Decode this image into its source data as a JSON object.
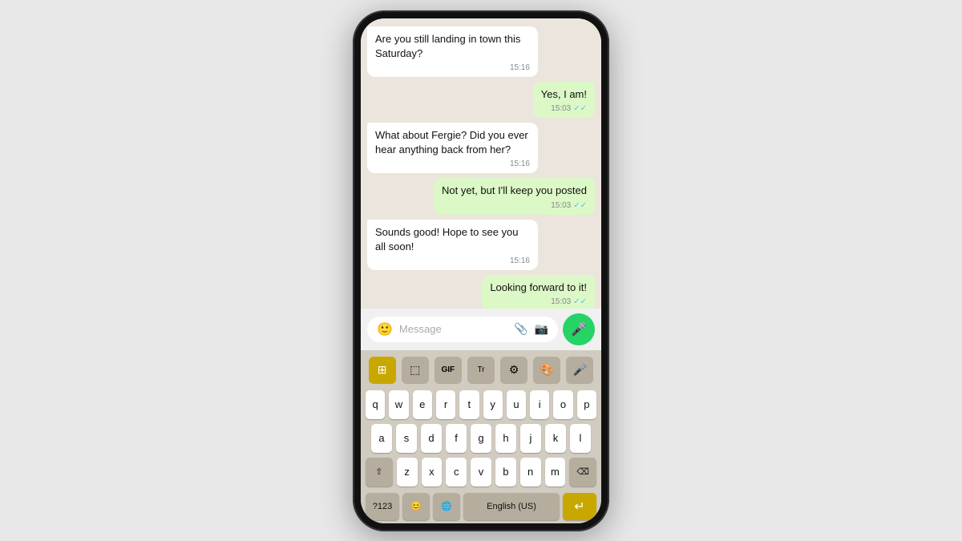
{
  "phone": {
    "messages": [
      {
        "id": "msg1",
        "type": "received",
        "text": "Are you still landing in town this Saturday?",
        "time": "15:16",
        "ticks": null
      },
      {
        "id": "msg2",
        "type": "sent",
        "text": "Yes, I am!",
        "time": "15:03",
        "ticks": "✓✓"
      },
      {
        "id": "msg3",
        "type": "received",
        "text": "What about Fergie? Did you ever hear anything back from her?",
        "time": "15:16",
        "ticks": null
      },
      {
        "id": "msg4",
        "type": "sent",
        "text": "Not yet, but I'll keep you posted",
        "time": "15:03",
        "ticks": "✓✓"
      },
      {
        "id": "msg5",
        "type": "received",
        "text": "Sounds good! Hope to see you all soon!",
        "time": "15:16",
        "ticks": null
      },
      {
        "id": "msg6",
        "type": "sent",
        "text": "Looking forward to it!",
        "time": "15:03",
        "ticks": "✓✓"
      }
    ],
    "input": {
      "placeholder": "Message"
    },
    "keyboard": {
      "toolbar": [
        "⊞",
        "⬚",
        "GIF",
        "Tr",
        "⚙",
        "🎨",
        "🎤"
      ],
      "row1": [
        "q",
        "w",
        "e",
        "r",
        "t",
        "y",
        "u",
        "i",
        "o",
        "p"
      ],
      "row2": [
        "a",
        "s",
        "d",
        "f",
        "g",
        "h",
        "j",
        "k",
        "l"
      ],
      "row3": [
        "z",
        "x",
        "c",
        "v",
        "b",
        "n",
        "m"
      ],
      "bottom": {
        "num": "?123",
        "emoji": "😊",
        "globe": "🌐",
        "lang": "English (US)",
        "enter_icon": "↵"
      }
    }
  }
}
